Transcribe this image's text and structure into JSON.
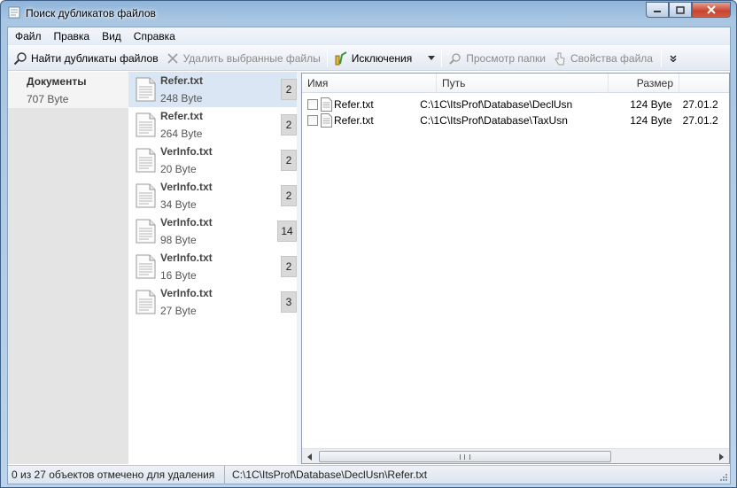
{
  "window": {
    "title": "Поиск дубликатов файлов"
  },
  "menu": [
    "Файл",
    "Правка",
    "Вид",
    "Справка"
  ],
  "toolbar": {
    "find": "Найти дубликаты файлов",
    "delete": "Удалить выбранные файлы",
    "exclusions": "Исключения",
    "browse": "Просмотр папки",
    "props": "Свойства файла",
    "overflow": "»"
  },
  "categories": [
    {
      "name": "Документы",
      "size": "707 Byte"
    }
  ],
  "groups": [
    {
      "name": "Refer.txt",
      "size": "248 Byte",
      "count": "2",
      "selected": true
    },
    {
      "name": "Refer.txt",
      "size": "264 Byte",
      "count": "2"
    },
    {
      "name": "VerInfo.txt",
      "size": "20 Byte",
      "count": "2"
    },
    {
      "name": "VerInfo.txt",
      "size": "34 Byte",
      "count": "2"
    },
    {
      "name": "VerInfo.txt",
      "size": "98 Byte",
      "count": "14"
    },
    {
      "name": "VerInfo.txt",
      "size": "16 Byte",
      "count": "2"
    },
    {
      "name": "VerInfo.txt",
      "size": "27 Byte",
      "count": "3"
    }
  ],
  "list": {
    "columns": {
      "name": "Имя",
      "path": "Путь",
      "size": "Размер",
      "date": ""
    },
    "rows": [
      {
        "name": "Refer.txt",
        "path": "C:\\1C\\ItsProf\\Database\\DeclUsn",
        "size": "124 Byte",
        "date": "27.01.2",
        "checked": false
      },
      {
        "name": "Refer.txt",
        "path": "C:\\1C\\ItsProf\\Database\\TaxUsn",
        "size": "124 Byte",
        "date": "27.01.2",
        "checked": false
      }
    ]
  },
  "status": {
    "left": "0 из 27 объектов отмечено для удаления",
    "right": "C:\\1C\\ItsProf\\Database\\DeclUsn\\Refer.txt"
  }
}
